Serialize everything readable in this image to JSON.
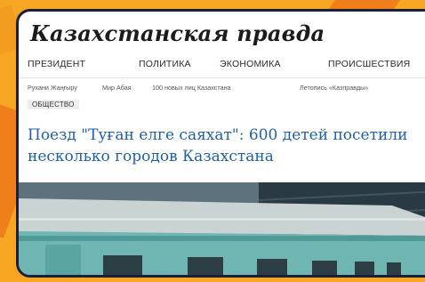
{
  "masthead": {
    "title": "Казахстанская правда"
  },
  "main_nav": {
    "items": [
      "ПРЕЗИДЕНТ",
      "ПОЛИТИКА",
      "ЭКОНОМИКА",
      "ПРОИСШЕСТВИЯ"
    ]
  },
  "sub_nav": {
    "items": [
      "Рухани Жаңғыру",
      "Мир Абая",
      "100 новых лиц Казахстана",
      "Летопись «Казправды»"
    ]
  },
  "section": {
    "label": "ОБЩЕСТВО"
  },
  "article": {
    "headline": "Поезд \"Туған елге саяхат\": 600 детей посетили несколько городов Казахстана"
  },
  "colors": {
    "background": "#f6a623",
    "accent_orange": "#ef7f1a",
    "card_border": "#1c1f3a",
    "headline": "#1f61a8",
    "train_body": "#6fb5b2"
  }
}
